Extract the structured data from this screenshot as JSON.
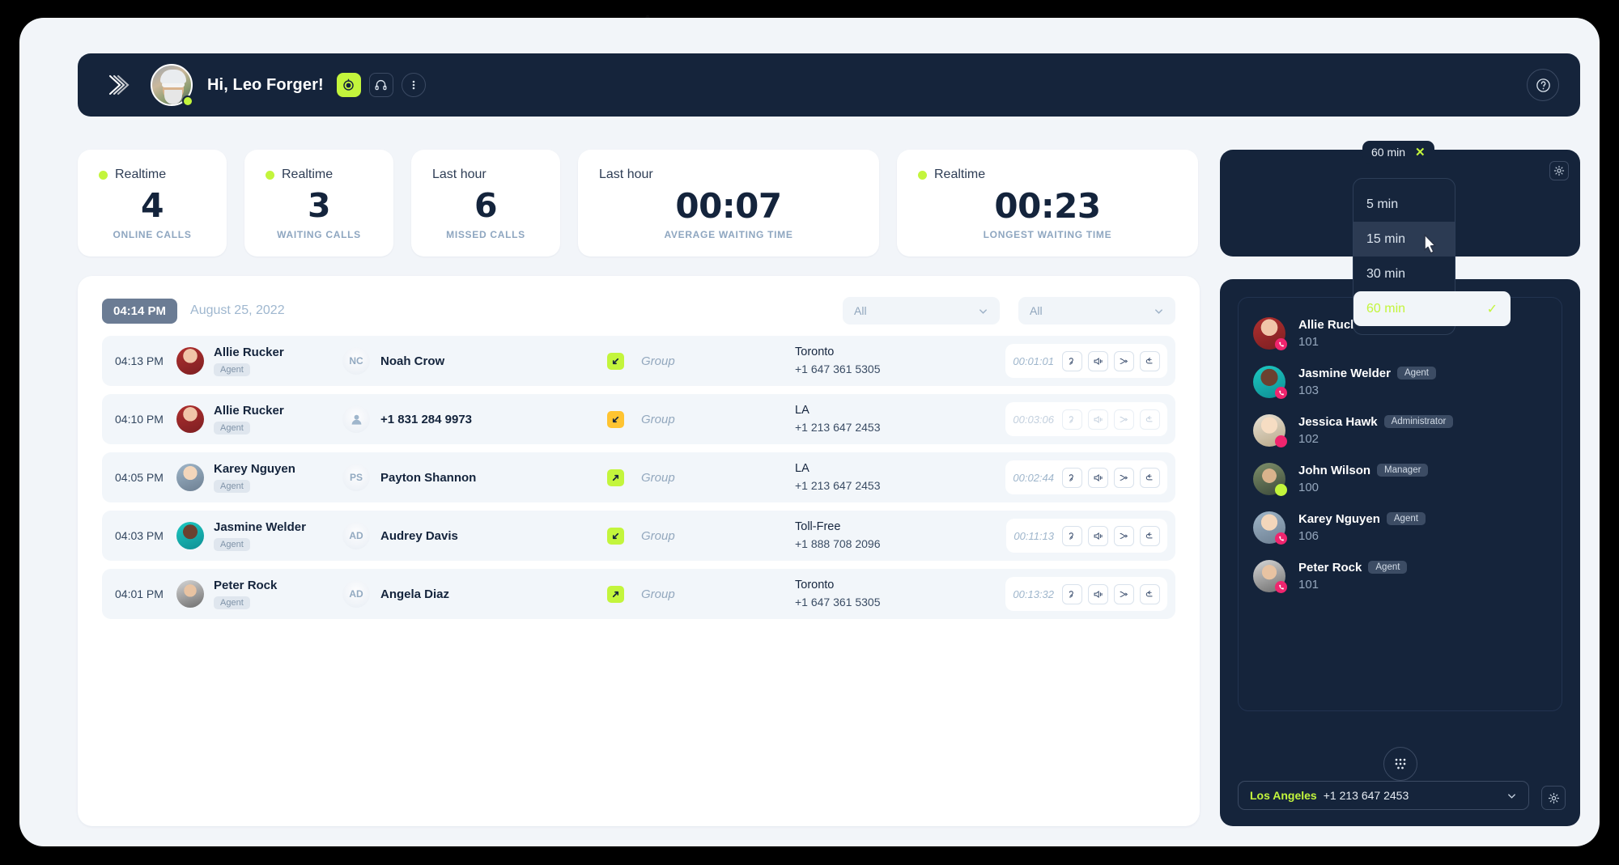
{
  "header": {
    "logo": "wave-logo-icon",
    "greeting": "Hi, Leo Forger!",
    "status_icon": "recording-icon",
    "headset_icon": "headset-icon",
    "more_icon": "more-vertical-icon",
    "help_icon": "help-circle-icon"
  },
  "stats": [
    {
      "period": "Realtime",
      "live": true,
      "value": "4",
      "label": "ONLINE CALLS"
    },
    {
      "period": "Realtime",
      "live": true,
      "value": "3",
      "label": "WAITING CALLS"
    },
    {
      "period": "Last hour",
      "live": false,
      "value": "6",
      "label": "MISSED CALLS"
    },
    {
      "period": "Last hour",
      "live": false,
      "value": "00:07",
      "label": "AVERAGE WAITING TIME"
    },
    {
      "period": "Realtime",
      "live": true,
      "value": "00:23",
      "label": "LONGEST WAITING TIME"
    }
  ],
  "panel": {
    "time_pill": "04:14 PM",
    "date": "August 25, 2022",
    "filter_left": "All",
    "filter_right": "All",
    "chevron_icon": "chevron-down-icon",
    "rows": [
      {
        "time": "04:13 PM",
        "agent": "Allie Rucker",
        "agent_role": "Agent",
        "party": "Noah Crow",
        "party_initials": "NC",
        "party_is_phone": false,
        "direction": "inbound",
        "direction_icon": "arrow-down-left-icon",
        "direction_color": "#c3f53c",
        "group": "Group",
        "location": "Toronto",
        "number": "+1 647 361 5305",
        "duration": "00:01:01",
        "dim": false
      },
      {
        "time": "04:10 PM",
        "agent": "Allie Rucker",
        "agent_role": "Agent",
        "party": "+1 831 284 9973",
        "party_initials": "",
        "party_is_phone": true,
        "direction": "inbound",
        "direction_icon": "arrow-down-left-icon",
        "direction_color": "#ffc431",
        "group": "Group",
        "location": "LA",
        "number": "+1 213 647 2453",
        "duration": "00:03:06",
        "dim": true
      },
      {
        "time": "04:05 PM",
        "agent": "Karey Nguyen",
        "agent_role": "Agent",
        "party": "Payton Shannon",
        "party_initials": "PS",
        "party_is_phone": false,
        "direction": "outbound",
        "direction_icon": "arrow-up-right-icon",
        "direction_color": "#c3f53c",
        "group": "Group",
        "location": "LA",
        "number": "+1 213 647 2453",
        "duration": "00:02:44",
        "dim": false
      },
      {
        "time": "04:03 PM",
        "agent": "Jasmine Welder",
        "agent_role": "Agent",
        "party": "Audrey Davis",
        "party_initials": "AD",
        "party_is_phone": false,
        "direction": "inbound",
        "direction_icon": "arrow-down-left-icon",
        "direction_color": "#c3f53c",
        "group": "Group",
        "location": "Toll-Free",
        "number": "+1 888 708 2096",
        "duration": "00:11:13",
        "dim": false
      },
      {
        "time": "04:01 PM",
        "agent": "Peter Rock",
        "agent_role": "Agent",
        "party": "Angela Diaz",
        "party_initials": "AD",
        "party_is_phone": false,
        "direction": "outbound",
        "direction_icon": "arrow-up-right-icon",
        "direction_color": "#c3f53c",
        "group": "Group",
        "location": "Toronto",
        "number": "+1 647 361 5305",
        "duration": "00:13:32",
        "dim": false
      }
    ],
    "action_icons": [
      "listen-in-icon",
      "whisper-icon",
      "transfer-icon",
      "barge-back-icon"
    ]
  },
  "kpi_card": {
    "value": "%",
    "gear_icon": "gear-icon"
  },
  "agents_panel": {
    "agents": [
      {
        "name": "Allie Rucker",
        "role": "Agent",
        "ext": "101",
        "status": "call"
      },
      {
        "name": "Jasmine Welder",
        "role": "Agent",
        "ext": "103",
        "status": "call"
      },
      {
        "name": "Jessica Hawk",
        "role": "Administrator",
        "ext": "102",
        "status": "busy"
      },
      {
        "name": "John Wilson",
        "role": "Manager",
        "ext": "100",
        "status": "free"
      },
      {
        "name": "Karey Nguyen",
        "role": "Agent",
        "ext": "106",
        "status": "call"
      },
      {
        "name": "Peter Rock",
        "role": "Agent",
        "ext": "101",
        "status": "call"
      }
    ],
    "dialpad_icon": "dialpad-icon",
    "location": {
      "city": "Los Angeles",
      "number": "+1 213 647 2453",
      "chevron_icon": "chevron-down-icon"
    },
    "settings_icon": "gear-icon"
  },
  "dropdown": {
    "chip_label": "60 min",
    "close_icon": "close-icon",
    "options": [
      {
        "label": "5 min",
        "selected": false,
        "highlighted": false
      },
      {
        "label": "15 min",
        "selected": false,
        "highlighted": true
      },
      {
        "label": "30 min",
        "selected": false,
        "highlighted": false
      },
      {
        "label": "60 min",
        "selected": true,
        "highlighted": false
      }
    ],
    "check_icon": "check-icon",
    "cursor_icon": "pointer-cursor-icon"
  },
  "colors": {
    "accent_lime": "#c3f53c",
    "dark_navy": "#15243b",
    "page_bg": "#f2f5f9",
    "amber": "#ffc431",
    "pink": "#f0256e"
  }
}
